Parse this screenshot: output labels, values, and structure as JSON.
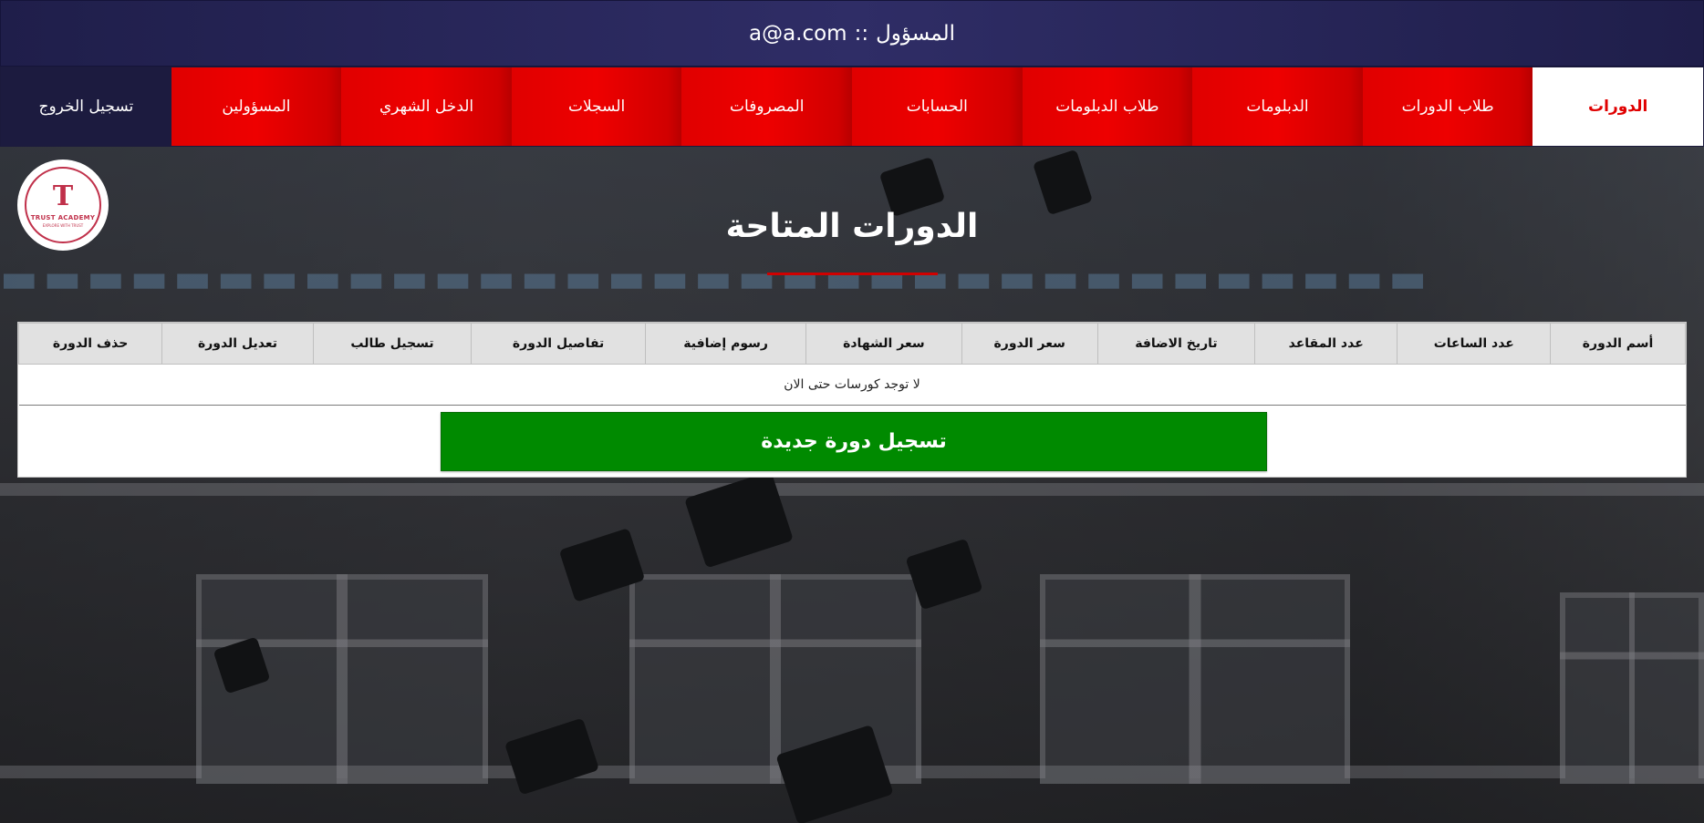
{
  "header": {
    "email": "a@a.com",
    "separator": "::",
    "role": "المسؤول"
  },
  "nav": {
    "items": [
      {
        "label": "الدورات",
        "active": true
      },
      {
        "label": "طلاب الدورات"
      },
      {
        "label": "الدبلومات"
      },
      {
        "label": "طلاب الدبلومات"
      },
      {
        "label": "الحسابات"
      },
      {
        "label": "المصروفات"
      },
      {
        "label": "السجلات"
      },
      {
        "label": "الدخل الشهري"
      },
      {
        "label": "المسؤولين"
      },
      {
        "label": "تسجيل الخروج"
      }
    ]
  },
  "logo": {
    "glyph": "T",
    "name": "TRUST ACADEMY",
    "tagline": "EXPLORE WITH TRUST"
  },
  "main": {
    "title": "الدورات المتاحة",
    "table": {
      "columns": [
        "أسم الدورة",
        "عدد الساعات",
        "عدد المقاعد",
        "تاريخ الاضافة",
        "سعر الدورة",
        "سعر الشهادة",
        "رسوم إضافية",
        "تفاصيل الدورة",
        "تسجيل طالب",
        "تعديل الدورة",
        "حذف الدورة"
      ],
      "empty_message": "لا توجد كورسات حتى الان"
    },
    "add_button": "تسجيل دورة جديدة"
  },
  "colors": {
    "header_bg": "#2a2960",
    "nav_red": "#e00000",
    "active_text": "#e00000",
    "add_button": "#008a00"
  }
}
